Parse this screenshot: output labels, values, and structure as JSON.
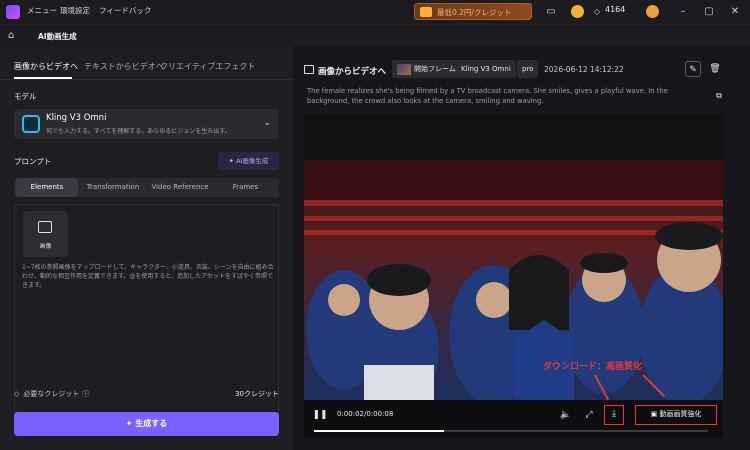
{
  "titlebar": {
    "menu": [
      "メニュー",
      "環境設定",
      "フィードバック"
    ],
    "promo": "最低0.2円/クレジット",
    "credits": "4164"
  },
  "subbar": {
    "title": "AI動画生成"
  },
  "left": {
    "tabs": [
      "画像からビデオへ",
      "テキストからビデオへ",
      "クリエイティブエフェクト"
    ],
    "model_label": "モデル",
    "model": {
      "name": "Kling V3 Omni",
      "desc": "何でも入力する。すべてを理解する。あらゆるビジョンを生み出す。"
    },
    "prompt_label": "プロンプト",
    "ai_button": "AI画像生成",
    "subtabs": [
      "Elements",
      "Transformation",
      "Video Reference",
      "Frames"
    ],
    "image_tile_label": "画像",
    "drop_help": "1~7枚の参照画像をアップロードして、キャラクター、小道具、衣装、シーンを自由に組み合わせ、動的な相互作用を定義できます。@を使用すると、追加したアセットをすばやく参照できます。",
    "required_credit_label": "必要なクレジット",
    "required_credit_value": "30クレジット",
    "generate": "生成する"
  },
  "right": {
    "title": "画像からビデオへ",
    "chip_frame": "開始フレーム",
    "chip_model": "Kling V3 Omni",
    "chip_pro": "pro",
    "timestamp": "2026-06-12 14:12:22",
    "prompt": "The female realizes she's being filmed by a TV broadcast camera. She smiles, gives a playful wave. In the background, the crowd also looks at the camera, smiling and waving.",
    "time": "0:00:02/0:00:08",
    "progress": 0.33,
    "hd_button": "動画画質強化",
    "overlay_text": "ダウンロード：高画質化"
  },
  "colors": {
    "accent": "#7b62ff",
    "highlight": "#e53935"
  },
  "icons": [
    "app-logo-icon",
    "gift-icon",
    "screen-icon",
    "coin-icon",
    "gem-icon",
    "avatar-icon",
    "minimize-icon",
    "maximize-icon",
    "close-icon",
    "home-icon",
    "chevron-down-icon",
    "image-icon",
    "info-icon",
    "sparkle-icon",
    "edit-icon",
    "trash-icon",
    "copy-icon",
    "pause-icon",
    "volume-icon",
    "fullscreen-icon",
    "download-icon",
    "enhance-icon"
  ]
}
